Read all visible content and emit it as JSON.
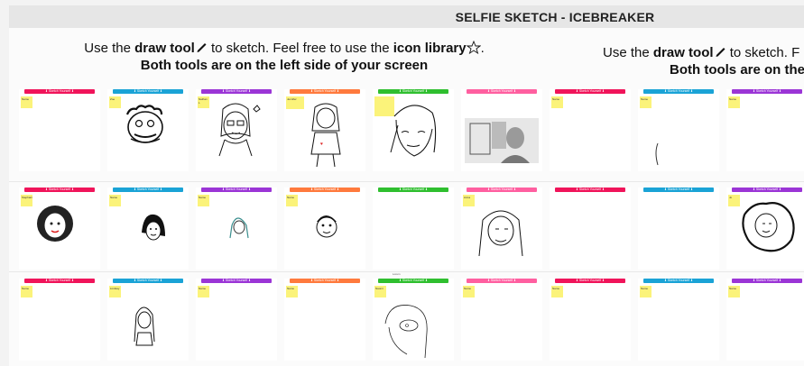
{
  "board": {
    "title": "SELFIE SKETCH - ICEBREAKER",
    "instructions": [
      {
        "line1_prefix": "Use the ",
        "draw_tool": "draw tool",
        "line1_middle": " to sketch. Feel free to use the ",
        "icon_library": "icon library",
        "line1_suffix": ".",
        "line2": "Both tools are on the left side of your screen"
      },
      {
        "line1_prefix": "Use the ",
        "draw_tool": "draw tool",
        "line1_middle": " to sketch. F",
        "line2": "Both tools are on the"
      }
    ],
    "palette": {
      "red": "#f0145a",
      "blue": "#1aa3d6",
      "purple": "#9b35d6",
      "orange": "#ff7a3d",
      "green": "#2fbf2f",
      "pink": "#ff5fa0",
      "sticky": "#fbf37a"
    },
    "band_label": "⬇ Sketch Yourself ⬇",
    "stickies": {
      "r1": [
        "Name",
        "Zoe",
        "Nathan L",
        "Jennifer",
        "",
        "Name",
        "Name",
        "Name",
        "Name"
      ],
      "r2": [
        "Stephanie",
        "Name",
        "Name",
        "Name",
        "",
        "Anna",
        "",
        "",
        "Jo"
      ],
      "r3": [
        "Name",
        "Lindsay",
        "Name",
        "Name",
        "Naomi",
        "Name",
        "Name",
        "Name",
        "Name"
      ]
    },
    "above_label_r3c5": "Lorem"
  }
}
